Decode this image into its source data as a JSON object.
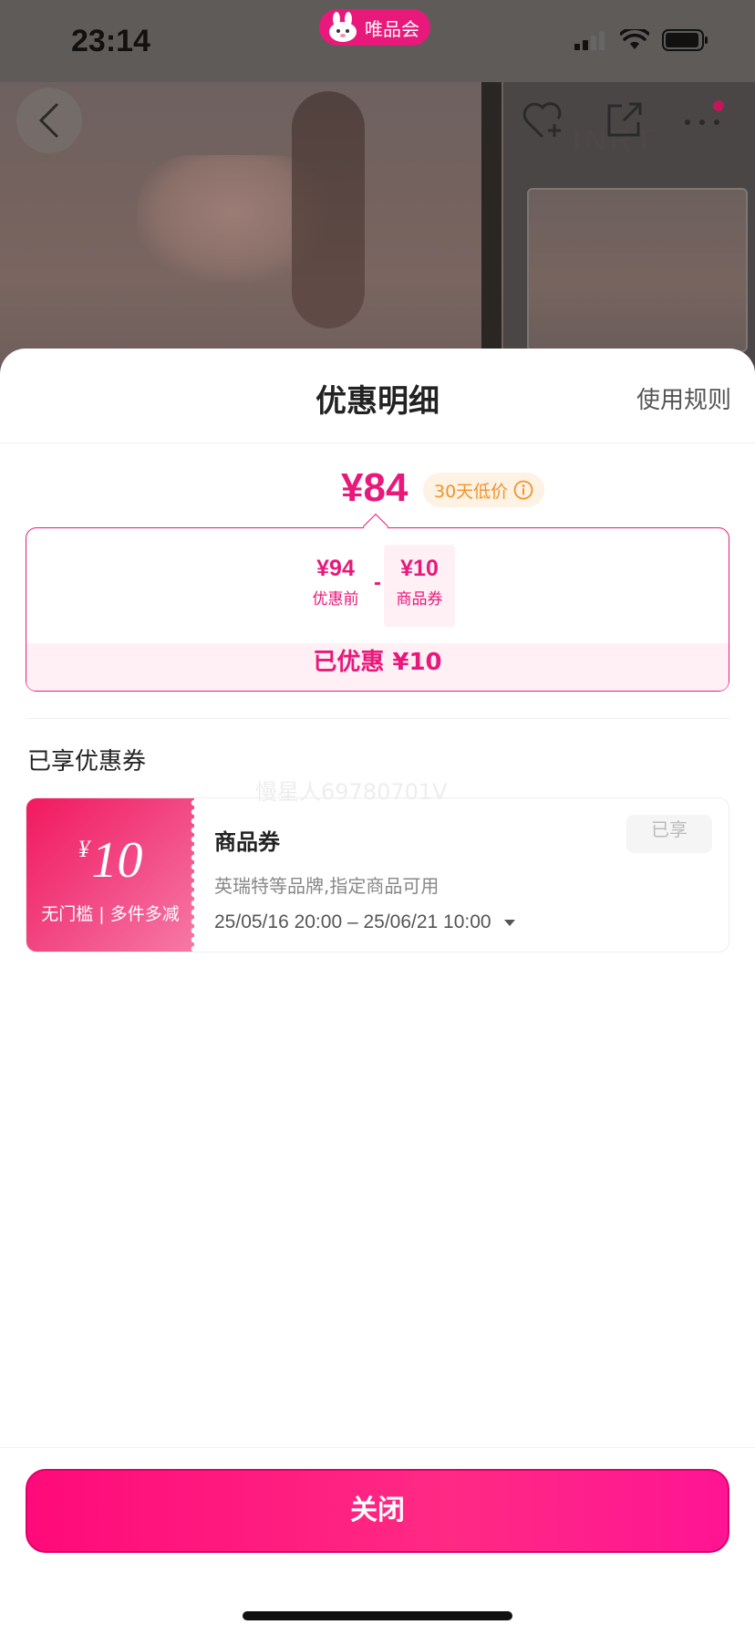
{
  "status_bar": {
    "time": "23:14",
    "app_name": "唯品会"
  },
  "background": {
    "brand_logo": "INRT"
  },
  "sheet": {
    "title": "优惠明细",
    "rules_link": "使用规则",
    "final_price": "¥84",
    "low_price_badge": "30天低价",
    "breakdown": {
      "original_amount": "¥94",
      "original_label": "优惠前",
      "operator": "-",
      "coupon_amount": "¥10",
      "coupon_label": "商品券",
      "saved_text": "已优惠 ¥10"
    },
    "section_title": "已享优惠券",
    "watermark": "慢星人69780701V",
    "coupon": {
      "currency": "¥",
      "value": "10",
      "conditions": "无门槛 | 多件多减",
      "name": "商品券",
      "status": "已享",
      "description": "英瑞特等品牌,指定商品可用",
      "valid_period": "25/05/16 20:00 – 25/06/21 10:00"
    },
    "close_button": "关闭"
  },
  "colors": {
    "accent": "#e8197b",
    "badge_bg": "#fdf2e3",
    "badge_text": "#f0932a"
  }
}
